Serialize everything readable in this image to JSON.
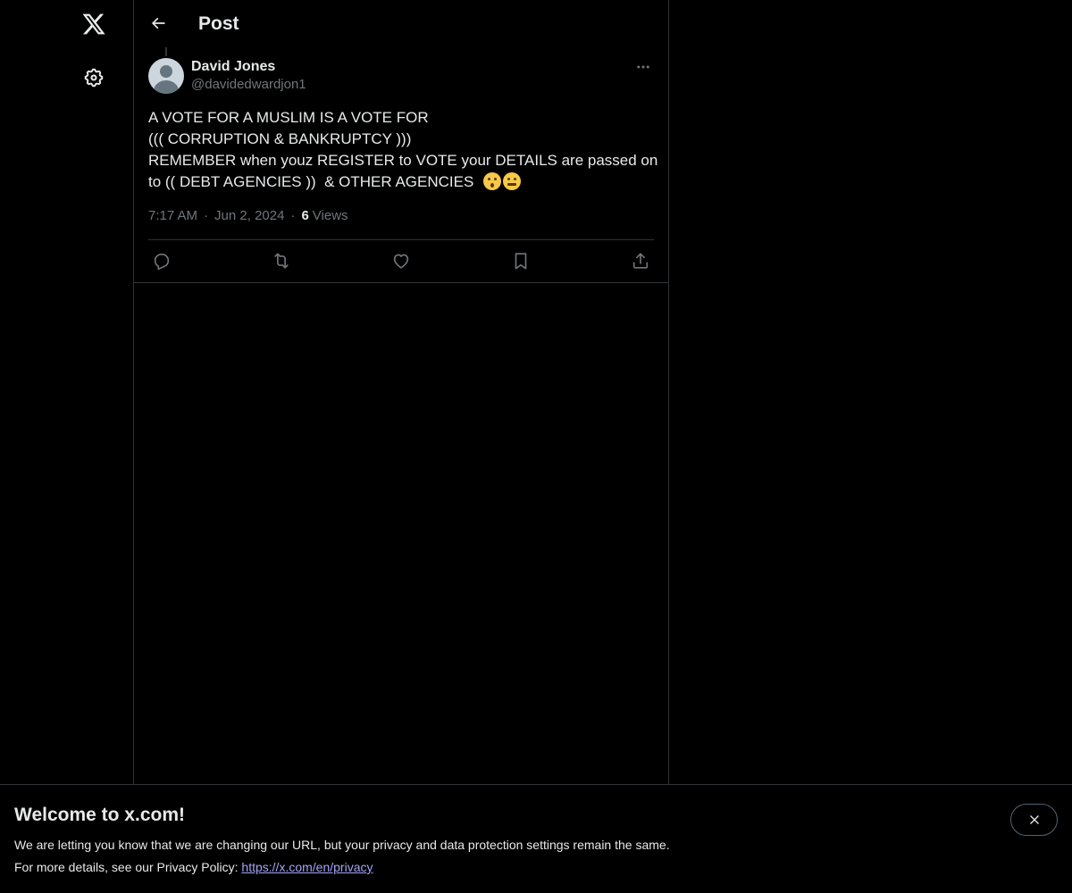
{
  "nav": {
    "logo_icon": "x-logo-icon",
    "settings_icon": "gear-icon"
  },
  "header": {
    "title": "Post",
    "back_icon": "arrow-left-icon"
  },
  "post": {
    "author": {
      "name": "David Jones",
      "handle": "@davidedwardjon1"
    },
    "lines": [
      "A VOTE FOR A MUSLIM IS A VOTE FOR",
      "((( CORRUPTION & BANKRUPTCY )))",
      "REMEMBER when youz REGISTER to VOTE your DETAILS are passed on",
      "to (( DEBT AGENCIES ))  & OTHER AGENCIES "
    ],
    "emojis": [
      "hushed-face-emoji",
      "zipper-mouth-face-emoji"
    ],
    "time": "7:17 AM",
    "date": "Jun 2, 2024",
    "separator": "·",
    "views_count": "6",
    "views_label": "Views",
    "actions": [
      "reply-icon",
      "repost-icon",
      "like-icon",
      "bookmark-icon",
      "share-icon"
    ]
  },
  "banner": {
    "title": "Welcome to x.com!",
    "line1": "We are letting you know that we are changing our URL, but your privacy and data protection settings remain the same.",
    "line2_prefix": "For more details, see our Privacy Policy: ",
    "link": "https://x.com/en/privacy",
    "close_icon": "close-icon"
  },
  "colors": {
    "background": "#000000",
    "text": "#e7e9ea",
    "secondary_text": "#71767b",
    "border": "#2f3336",
    "link": "#a5a4f7"
  }
}
